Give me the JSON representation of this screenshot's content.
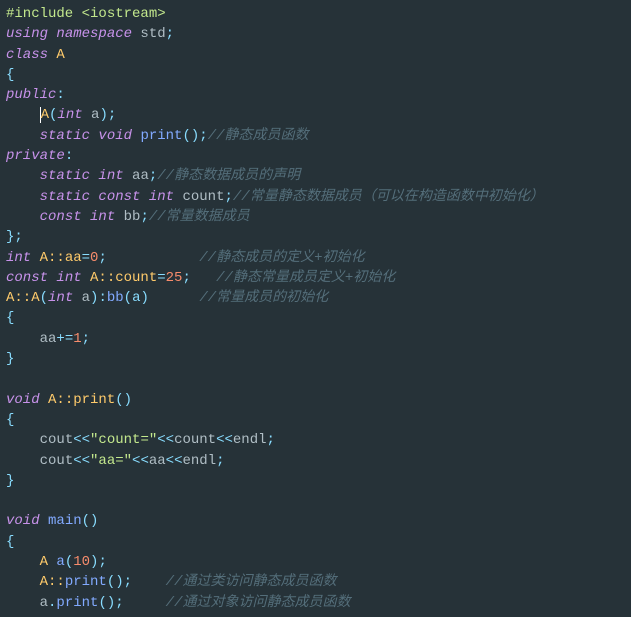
{
  "code": {
    "l1_include": "#include",
    "l1_header": " <iostream>",
    "l2_using": "using",
    "l2_ns": " namespace",
    "l2_std": " std",
    "l2_end": ";",
    "l3_class": "class",
    "l3_A": " A",
    "l4": "{",
    "l5_public": "public",
    "l5_colon": ":",
    "l6_ctor": "A",
    "l6_p1": "(",
    "l6_int": "int",
    "l6_a": " a",
    "l6_p2": ")",
    "l6_end": ";",
    "l7_static": "static",
    "l7_void": " void",
    "l7_print": " print",
    "l7_p": "()",
    "l7_end": ";",
    "l7_cmt": "//静态成员函数",
    "l8_private": "private",
    "l8_colon": ":",
    "l9_static": "static",
    "l9_int": " int",
    "l9_aa": " aa",
    "l9_end": ";",
    "l9_cmt": "//静态数据成员的声明",
    "l10_static": "static",
    "l10_const": " const",
    "l10_int": " int",
    "l10_count": " count",
    "l10_end": ";",
    "l10_cmt": "//常量静态数据成员（可以在构造函数中初始化）",
    "l11_const": "const",
    "l11_int": " int",
    "l11_bb": " bb",
    "l11_end": ";",
    "l11_cmt": "//常量数据成员",
    "l12": "};",
    "l13_int": "int",
    "l13_scope": " A::aa",
    "l13_eq": "=",
    "l13_val": "0",
    "l13_end": ";",
    "l13_cmt": "//静态成员的定义+初始化",
    "l14_const": "const",
    "l14_int": " int",
    "l14_scope": " A::count",
    "l14_eq": "=",
    "l14_val": "25",
    "l14_end": ";",
    "l14_cmt": "//静态常量成员定义+初始化",
    "l15_scope": "A::A",
    "l15_p1": "(",
    "l15_int": "int",
    "l15_a": " a",
    "l15_p2": "):",
    "l15_bb": "bb",
    "l15_p3": "(a)",
    "l15_cmt": "//常量成员的初始化",
    "l16": "{",
    "l17_aa": "aa",
    "l17_op": "+=",
    "l17_val": "1",
    "l17_end": ";",
    "l18": "}",
    "l20_void": "void",
    "l20_scope": " A::print",
    "l20_p": "()",
    "l21": "{",
    "l22_cout": "cout",
    "l22_op1": "<<",
    "l22_str": "\"count=\"",
    "l22_op2": "<<",
    "l22_count": "count",
    "l22_op3": "<<",
    "l22_endl": "endl",
    "l22_end": ";",
    "l23_cout": "cout",
    "l23_op1": "<<",
    "l23_str": "\"aa=\"",
    "l23_op2": "<<",
    "l23_aa": "aa",
    "l23_op3": "<<",
    "l23_endl": "endl",
    "l23_end": ";",
    "l24": "}",
    "l26_void": "void",
    "l26_main": " main",
    "l26_p": "()",
    "l27": "{",
    "l28_A": "A ",
    "l28_a": "a",
    "l28_p": "(",
    "l28_val": "10",
    "l28_p2": ")",
    "l28_end": ";",
    "l29_scope": "A::",
    "l29_print": "print",
    "l29_p": "()",
    "l29_end": ";",
    "l29_cmt": "//通过类访问静态成员函数",
    "l30_a": "a",
    "l30_dot": ".",
    "l30_print": "print",
    "l30_p": "()",
    "l30_end": ";",
    "l30_cmt": "//通过对象访问静态成员函数"
  }
}
